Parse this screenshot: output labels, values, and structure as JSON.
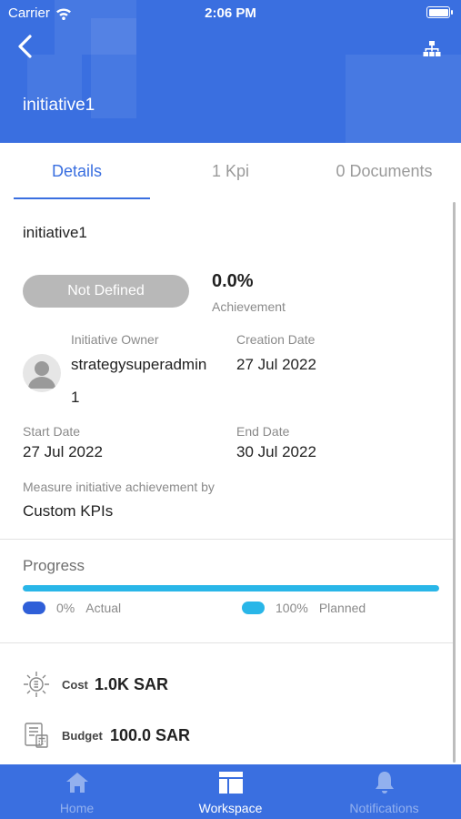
{
  "status_bar": {
    "carrier": "Carrier",
    "time": "2:06 PM"
  },
  "header": {
    "title": "initiative1"
  },
  "tabs": [
    {
      "label": "Details",
      "active": true
    },
    {
      "label": "1 Kpi",
      "active": false
    },
    {
      "label": "0 Documents",
      "active": false
    }
  ],
  "details": {
    "name": "initiative1",
    "status": "Not Defined",
    "achievement_value": "0.0%",
    "achievement_label": "Achievement",
    "owner_label": "Initiative Owner",
    "owner_line1": "strategysuperadmin",
    "owner_line2": "1",
    "creation_label": "Creation Date",
    "creation_value": "27 Jul 2022",
    "start_label": "Start Date",
    "start_value": "27 Jul 2022",
    "end_label": "End Date",
    "end_value": "30 Jul 2022",
    "measure_label": "Measure initiative achievement by",
    "measure_value": "Custom KPIs"
  },
  "progress": {
    "title": "Progress",
    "actual_percent": 0,
    "planned_percent": 100,
    "actual_pct_label": "0%",
    "actual_label": "Actual",
    "planned_pct_label": "100%",
    "planned_label": "Planned",
    "actual_color": "#2f5fd8",
    "planned_color": "#29b6e8"
  },
  "finance": {
    "cost_label": "Cost",
    "cost_value": "1.0K SAR",
    "budget_label": "Budget",
    "budget_value": "100.0 SAR"
  },
  "bottom_nav": [
    {
      "label": "Home",
      "icon": "home-icon",
      "active": false
    },
    {
      "label": "Workspace",
      "icon": "workspace-icon",
      "active": true
    },
    {
      "label": "Notifications",
      "icon": "bell-icon",
      "active": false
    }
  ],
  "colors": {
    "primary": "#3a6fe0",
    "pill_gray": "#b8b8b8"
  }
}
